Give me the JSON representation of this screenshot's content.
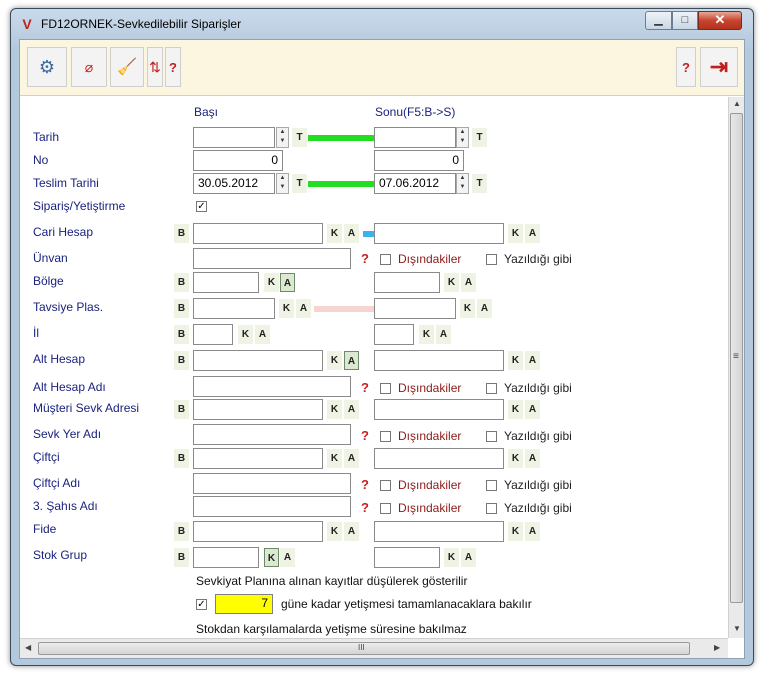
{
  "window": {
    "title": "FD12ORNEK-Sevkedilebilir Siparişler",
    "icon": "app-logo-icon"
  },
  "controls": {
    "minimize": "▁",
    "maximize": "□",
    "close": "✕"
  },
  "toolbar": {
    "settings": "⚙",
    "filter": "⌀",
    "clean": "🧹",
    "sort": "⇅",
    "help_left": "?",
    "help_right": "?",
    "exit": "⇥"
  },
  "headers": {
    "start": "Başı",
    "end": "Sonu(F5:B->S)"
  },
  "labels": {
    "tarih": "Tarih",
    "no": "No",
    "teslim": "Teslim Tarihi",
    "siparis": "Sipariş/Yetiştirme",
    "cari": "Cari Hesap",
    "unvan": "Ünvan",
    "bolge": "Bölge",
    "tavsiye": "Tavsiye Plas.",
    "il": "İl",
    "alt_hesap": "Alt Hesap",
    "alt_hesap_adi": "Alt Hesap Adı",
    "musteri": "Müşteri Sevk Adresi",
    "sevk_yer": "Sevk Yer Adı",
    "ciftci": "Çiftçi",
    "ciftci_adi": "Çiftçi Adı",
    "sahis": "3. Şahıs Adı",
    "fide": "Fide",
    "stok": "Stok Grup"
  },
  "values": {
    "no_start": "0",
    "no_end": "0",
    "teslim_start": "30.05.2012",
    "teslim_end": "07.06.2012",
    "days": "7"
  },
  "small": {
    "b": "B",
    "k": "K",
    "a": "A",
    "t": "T",
    "q": "?"
  },
  "checks": {
    "dis": "Dışındakiler",
    "yaz": "Yazıldığı gibi",
    "check": "✓"
  },
  "notes": {
    "sevkiyat": "Sevkiyat Planına alınan kayıtlar düşülerek gösterilir",
    "gune": "güne kadar yetişmesi tamamlanacaklara bakılır",
    "stokdan": "Stokdan karşılamalarda yetişme süresine bakılmaz"
  },
  "scroll": {
    "up": "▲",
    "down": "▼",
    "left": "◀",
    "right": "▶",
    "grip": "≡",
    "hgrip": "III"
  },
  "colors": {
    "accent_green": "#22dd22",
    "accent_blue": "#3bb3ea",
    "accent_pink": "#f6d4d2",
    "highlight_yellow": "#ffff00",
    "label_blue": "#1a237e"
  }
}
